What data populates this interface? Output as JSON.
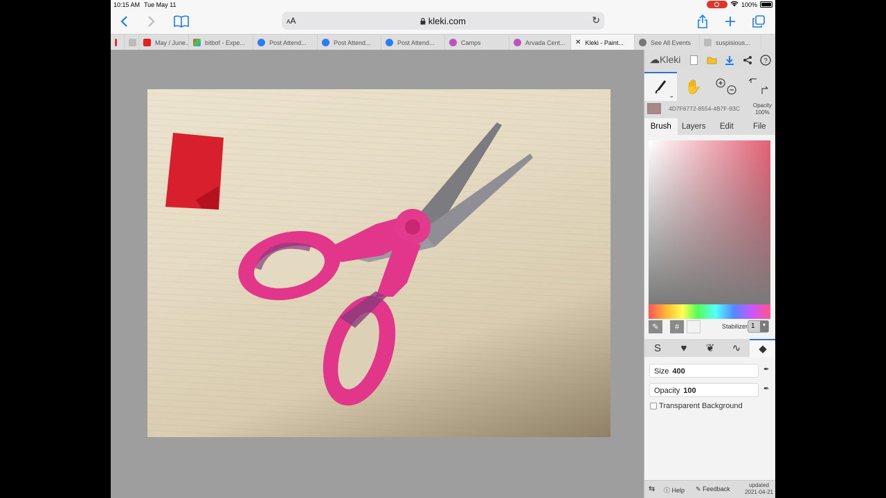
{
  "status_bar": {
    "time": "10:15 AM",
    "date": "Tue May 11",
    "battery": "100%"
  },
  "address_bar": {
    "aa_label": "AA",
    "url": "kleki.com"
  },
  "tabs": [
    {
      "title": "",
      "color": "#d33"
    },
    {
      "title": "",
      "color": "#bbb"
    },
    {
      "title": "May / June...",
      "color": "#d22"
    },
    {
      "title": "bitbof - Expe...",
      "color": "#4a8"
    },
    {
      "title": "Post Attend...",
      "color": "#2b7cf0"
    },
    {
      "title": "Post Attend...",
      "color": "#2b7cf0"
    },
    {
      "title": "Post Attend...",
      "color": "#2b7cf0"
    },
    {
      "title": "Camps",
      "color": "#b5b"
    },
    {
      "title": "Arvada Cent...",
      "color": "#b5b"
    },
    {
      "title": "Kleki - Paint...",
      "color": "#777"
    },
    {
      "title": "See All Events",
      "color": "#555"
    },
    {
      "title": "suspisious...",
      "color": "#bbb"
    }
  ],
  "panel": {
    "logo": "Kleki",
    "layer_name": "4D7F6772-8554-4B7F-93C",
    "layer_opacity_label": "Opacity",
    "layer_opacity_value": "100%",
    "tabs": [
      "Brush",
      "Layers",
      "Edit",
      "File"
    ],
    "hex_button": "#",
    "stabilizer_label": "Stabilizer",
    "stabilizer_value": "1",
    "size_label": "Size",
    "size_value": "400",
    "opacity_label": "Opacity",
    "opacity_value": "100",
    "transparent_bg_label": "Transparent Background",
    "footer": {
      "help": "Help",
      "feedback": "Feedback",
      "updated_label": "updated",
      "updated_date": "2021-04-21"
    }
  }
}
